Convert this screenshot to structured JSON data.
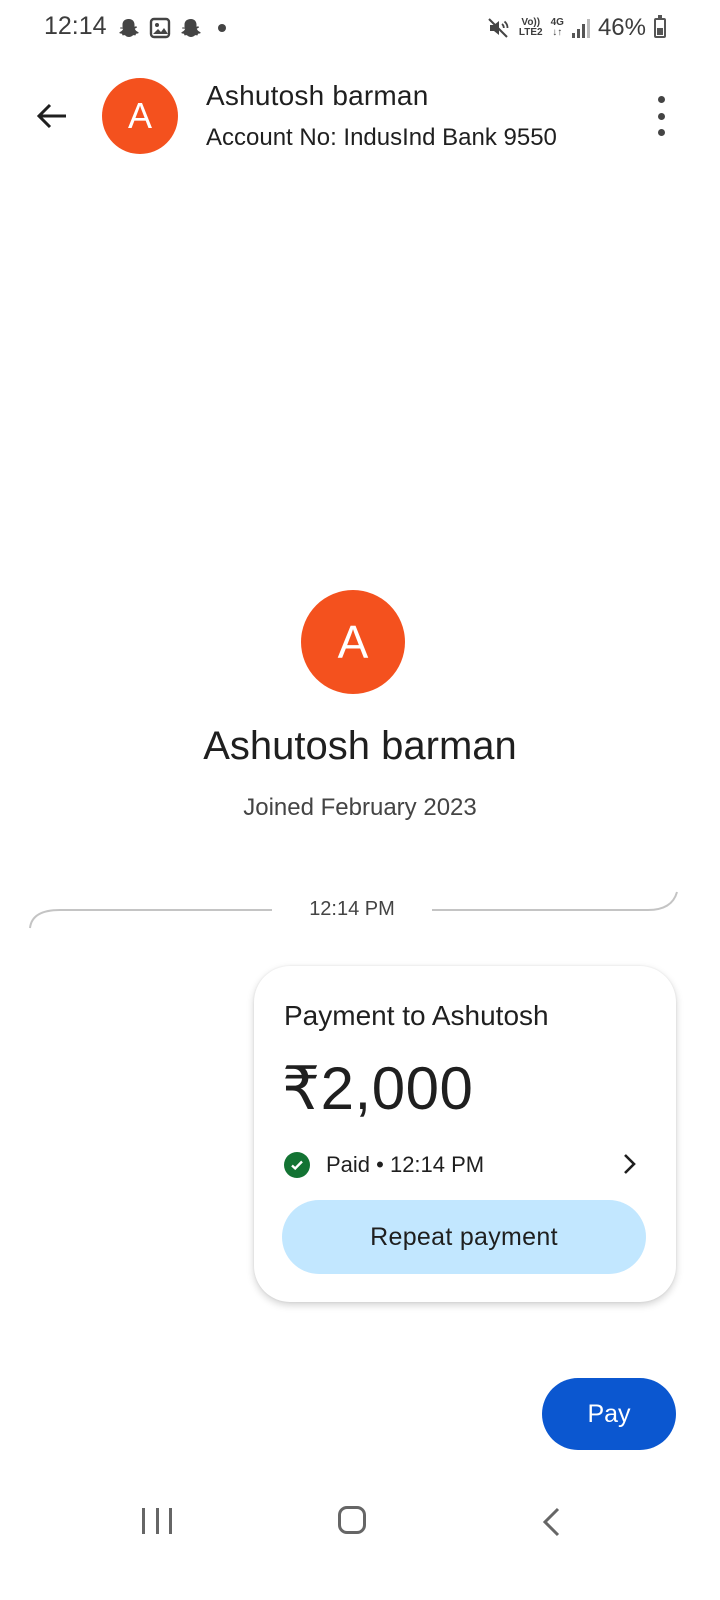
{
  "status_bar": {
    "time": "12:14",
    "volte": "Vo))",
    "lte": "LTE2",
    "network": "4G",
    "battery": "46%",
    "battery_level": 0.46,
    "icons": [
      "snapchat-icon",
      "gallery-icon",
      "snapchat-icon",
      "dot-icon",
      "mute-icon",
      "signal-icon",
      "battery-icon"
    ]
  },
  "header": {
    "avatar_letter": "A",
    "name": "Ashutosh barman",
    "account": "Account No: IndusInd Bank 9550"
  },
  "profile": {
    "avatar_letter": "A",
    "name": "Ashutosh barman",
    "joined": "Joined February 2023"
  },
  "timeline": {
    "timestamp": "12:14 PM"
  },
  "payment_card": {
    "title": "Payment to Ashutosh",
    "amount": "₹2,000",
    "status": "Paid • 12:14 PM",
    "repeat_label": "Repeat payment"
  },
  "pay_button": {
    "label": "Pay"
  },
  "colors": {
    "avatar": "#f4511e",
    "pay_button": "#0b57d0",
    "repeat_button": "#c2e7ff",
    "paid_check": "#137333"
  }
}
